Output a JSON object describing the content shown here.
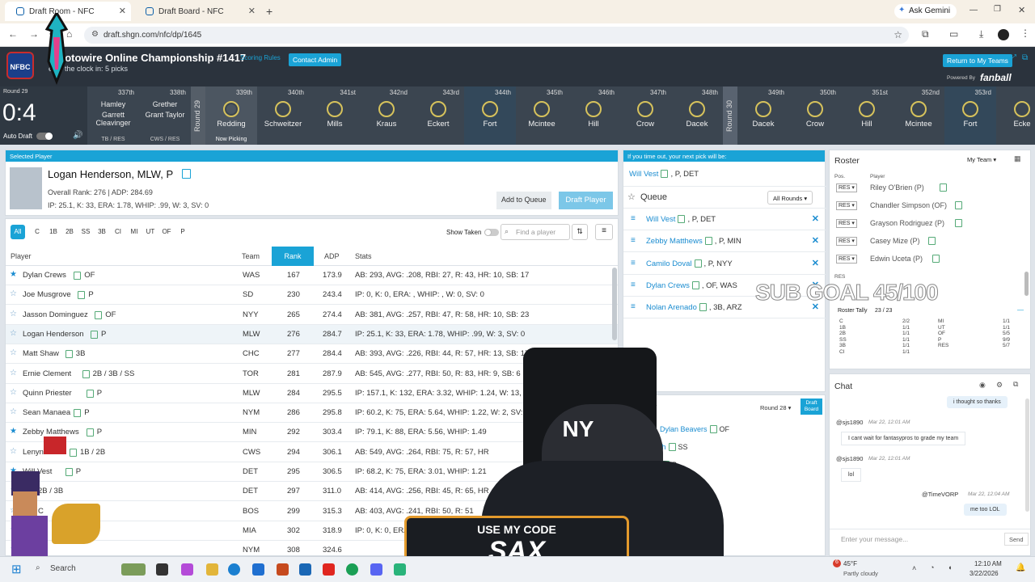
{
  "browser": {
    "tabs": [
      {
        "title": "Draft Room - NFC",
        "active": true
      },
      {
        "title": "Draft Board - NFC",
        "active": false
      }
    ],
    "ask_gemini": "Ask Gemini",
    "url": "draft.shgn.com/nfc/dp/1645"
  },
  "header": {
    "logo": "NFBC",
    "title": "0 Rotowire Online Championship #1417",
    "scoring_rules": "Scoring Rules",
    "contact_admin": "Contact Admin",
    "subtitle": "e on the clock in: 5 picks",
    "return_button": "Return to My Teams",
    "powered_by": "Powered By",
    "brand": "fanball"
  },
  "clock": {
    "round": "Round 29",
    "time": "0:4",
    "auto_draft": "Auto Draft"
  },
  "picks_left": [
    {
      "no": "337th",
      "line1": "Hamley",
      "line2": "Garrett Cleavinger",
      "team": "TB / RES"
    },
    {
      "no": "338th",
      "line1": "Grether",
      "line2": "Grant Taylor",
      "team": "CWS / RES"
    }
  ],
  "pick_rounds": [
    {
      "label": "Round 29",
      "picks": [
        {
          "no": "339th",
          "name": "Redding",
          "now": "Now Picking"
        },
        {
          "no": "340th",
          "name": "Schweitzer"
        },
        {
          "no": "341st",
          "name": "Mills"
        },
        {
          "no": "342nd",
          "name": "Kraus"
        },
        {
          "no": "343rd",
          "name": "Eckert"
        },
        {
          "no": "344th",
          "name": "Fort",
          "mine": true
        },
        {
          "no": "345th",
          "name": "Mcintee"
        },
        {
          "no": "346th",
          "name": "Hill"
        },
        {
          "no": "347th",
          "name": "Crow"
        },
        {
          "no": "348th",
          "name": "Dacek"
        }
      ]
    },
    {
      "label": "Round 30",
      "picks": [
        {
          "no": "349th",
          "name": "Dacek"
        },
        {
          "no": "350th",
          "name": "Crow"
        },
        {
          "no": "351st",
          "name": "Hill"
        },
        {
          "no": "352nd",
          "name": "Mcintee"
        },
        {
          "no": "353rd",
          "name": "Fort",
          "mine": true
        },
        {
          "no": "",
          "name": "Ecke"
        }
      ]
    }
  ],
  "selected": {
    "head": "Selected Player",
    "name": "Logan Henderson, MLW, P",
    "rank_line": "Overall Rank: 276 | ADP: 284.69",
    "stats_line": "IP: 25.1, K: 33, ERA: 1.78, WHIP: .99, W: 3, SV: 0",
    "add_queue": "Add to Queue",
    "draft_player": "Draft Player"
  },
  "filters": {
    "positions": [
      "All",
      "C",
      "1B",
      "2B",
      "SS",
      "3B",
      "CI",
      "MI",
      "UT",
      "OF",
      "P"
    ],
    "show_taken": "Show Taken",
    "search_placeholder": "Find a player"
  },
  "table": {
    "headers": [
      "Player",
      "Team",
      "Rank",
      "ADP",
      "Stats"
    ],
    "rows": [
      {
        "star": true,
        "name": "Dylan Crews",
        "pos": "OF",
        "team": "WAS",
        "rank": "167",
        "adp": "173.9",
        "stats": "AB: 293, AVG: .208, RBI: 27, R: 43, HR: 10, SB: 17"
      },
      {
        "star": false,
        "name": "Joe Musgrove",
        "pos": "P",
        "team": "SD",
        "rank": "230",
        "adp": "243.4",
        "stats": "IP: 0, K: 0, ERA: , WHIP: , W: 0, SV: 0"
      },
      {
        "star": false,
        "name": "Jasson Dominguez",
        "pos": "OF",
        "team": "NYY",
        "rank": "265",
        "adp": "274.4",
        "stats": "AB: 381, AVG: .257, RBI: 47, R: 58, HR: 10, SB: 23"
      },
      {
        "star": false,
        "name": "Logan Henderson",
        "pos": "P",
        "team": "MLW",
        "rank": "276",
        "adp": "284.7",
        "stats": "IP: 25.1, K: 33, ERA: 1.78, WHIP: .99, W: 3, SV: 0",
        "selected": true
      },
      {
        "star": false,
        "name": "Matt Shaw",
        "pos": "3B",
        "team": "CHC",
        "rank": "277",
        "adp": "284.4",
        "stats": "AB: 393, AVG: .226, RBI: 44, R: 57, HR: 13, SB: 17"
      },
      {
        "star": false,
        "name": "Ernie Clement",
        "pos": "2B / 3B / SS",
        "team": "TOR",
        "rank": "281",
        "adp": "287.9",
        "stats": "AB: 545, AVG: .277, RBI: 50, R: 83, HR: 9, SB: 6"
      },
      {
        "star": false,
        "name": "Quinn Priester",
        "pos": "P",
        "team": "MLW",
        "rank": "284",
        "adp": "295.5",
        "stats": "IP: 157.1, K: 132, ERA: 3.32, WHIP: 1.24, W: 13, SV:"
      },
      {
        "star": false,
        "name": "Sean Manaea",
        "pos": "P",
        "team": "NYM",
        "rank": "286",
        "adp": "295.8",
        "stats": "IP: 60.2, K: 75, ERA: 5.64, WHIP: 1.22, W: 2, SV: 0"
      },
      {
        "star": true,
        "name": "Zebby Matthews",
        "pos": "P",
        "team": "MIN",
        "rank": "292",
        "adp": "303.4",
        "stats": "IP: 79.1, K: 88, ERA: 5.56, WHIP: 1.49"
      },
      {
        "star": false,
        "name": "Lenyn Sosa",
        "pos": "1B / 2B",
        "team": "CWS",
        "rank": "294",
        "adp": "306.1",
        "stats": "AB: 549, AVG: .264, RBI: 75, R: 57, HR"
      },
      {
        "star": true,
        "name": "Will Vest",
        "pos": "P",
        "team": "DET",
        "rank": "295",
        "adp": "306.5",
        "stats": "IP: 68.2, K: 75, ERA: 3.01, WHIP: 1.21"
      },
      {
        "star": false,
        "name": "",
        "pos": "2B / 3B",
        "team": "DET",
        "rank": "297",
        "adp": "311.0",
        "stats": "AB: 414, AVG: .256, RBI: 45, R: 65, HR"
      },
      {
        "star": false,
        "name": "",
        "pos": "C",
        "team": "BOS",
        "rank": "299",
        "adp": "315.3",
        "stats": "AB: 403, AVG: .241, RBI: 50, R: 51"
      },
      {
        "star": false,
        "name": "",
        "pos": "",
        "team": "MIA",
        "rank": "302",
        "adp": "318.9",
        "stats": "IP: 0, K: 0, ERA: , WHIP: , W: 0"
      },
      {
        "star": false,
        "name": "",
        "pos": "",
        "team": "NYM",
        "rank": "308",
        "adp": "324.6",
        "stats": ""
      }
    ]
  },
  "next_pick": {
    "head": "If you time out, your next pick will be:",
    "name": "Will Vest",
    "pos": ", P, DET"
  },
  "queue": {
    "title": "Queue",
    "filter": "All Rounds",
    "items": [
      {
        "name": "Will Vest",
        "pos": ", P, DET"
      },
      {
        "name": "Zebby Matthews",
        "pos": ", P, MIN"
      },
      {
        "name": "Camilo Doval",
        "pos": ", P, NYY"
      },
      {
        "name": "Dylan Crews",
        "pos": ", OF, WAS"
      },
      {
        "name": "Nolan Arenado",
        "pos": ", 3B, ARZ"
      }
    ]
  },
  "history": {
    "title": "ry",
    "round": "Round 28",
    "draft_board": "Draft Board",
    "items": [
      {
        "name": "Dylan Beavers",
        "pos": "OF"
      },
      {
        "name": "th",
        "pos": "SS"
      },
      {
        "name": "",
        "pos": "P"
      },
      {
        "name": "eller",
        "pos": "P"
      },
      {
        "name": "",
        "pos": "2B"
      }
    ]
  },
  "roster": {
    "title": "Roster",
    "team": "My Team",
    "col_pos": "Pos.",
    "col_player": "Player",
    "rows": [
      {
        "slot": "RES",
        "player": "Riley O'Brien (P)"
      },
      {
        "slot": "RES",
        "player": "Chandler Simpson (OF)"
      },
      {
        "slot": "RES",
        "player": "Grayson Rodriguez (P)"
      },
      {
        "slot": "RES",
        "player": "Casey Mize (P)"
      },
      {
        "slot": "RES",
        "player": "Edwin Uceta (P)"
      }
    ],
    "res_label": "RES",
    "tally_label": "Roster Tally",
    "tally_total": "23 / 23",
    "tally": [
      [
        "C",
        "2/2",
        "MI",
        "1/1"
      ],
      [
        "1B",
        "1/1",
        "UT",
        "1/1"
      ],
      [
        "2B",
        "1/1",
        "OF",
        "5/5"
      ],
      [
        "SS",
        "1/1",
        "P",
        "9/9"
      ],
      [
        "3B",
        "1/1",
        "RES",
        "5/7"
      ],
      [
        "CI",
        "1/1",
        "",
        ""
      ]
    ]
  },
  "overlay": {
    "sub_goal": "SUB GOAL 45/100",
    "code_line1": "USE MY CODE",
    "code_line2": "SAX"
  },
  "chat": {
    "title": "Chat",
    "messages": [
      {
        "me": true,
        "text": "i thought so thanks"
      },
      {
        "me": false,
        "user": "@sjs1890",
        "time": "Mar 22, 12:01 AM",
        "text": "I cant wait for fantasypros to grade my team"
      },
      {
        "me": false,
        "user": "@sjs1890",
        "time": "Mar 22, 12:01 AM",
        "text": "lol"
      },
      {
        "me": true,
        "user": "@TimeVORP",
        "time": "Mar 22, 12:04 AM",
        "text": "me too LOL"
      }
    ],
    "placeholder": "Enter your message...",
    "send": "Send"
  },
  "taskbar": {
    "search": "Search",
    "weather_temp": "45°F",
    "weather_desc": "Partly cloudy",
    "time": "12:10 AM",
    "date": "3/22/2026",
    "badge": "6"
  },
  "colors": {
    "accent": "#1aa3d6",
    "header": "#2b333d",
    "pickbar": "#3b4550",
    "ring": "#d6c25c",
    "sax_border": "#e39a2c"
  }
}
